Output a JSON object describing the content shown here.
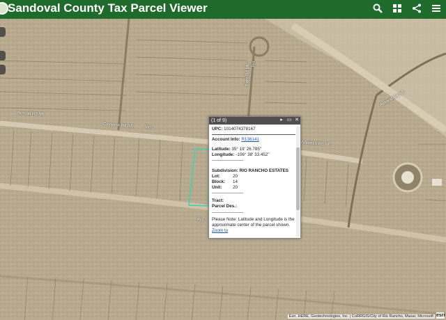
{
  "app": {
    "title": "Sandoval County Tax Parcel Viewer"
  },
  "toolbar": {
    "icons": [
      "search-icon",
      "apps-grid-icon",
      "share-icon",
      "menu-icon"
    ]
  },
  "map": {
    "streets": [
      {
        "label": "Cayenne Rd NE"
      },
      {
        "label": "Vinc"
      },
      {
        "label": "Allineum Rd NE"
      },
      {
        "label": "Tigre Rd NE"
      },
      {
        "label": "Almond Rd NE"
      },
      {
        "label": "Nomad Rd NE"
      },
      {
        "label": "Tex"
      },
      {
        "label": "Pro"
      }
    ],
    "attribution": "Esri, HERE, Geotechnologies, Inc. | CoRRGIS/City of Rio Rancho, Maxar, Microsoft",
    "esri_badge": "esri"
  },
  "popup": {
    "counter": "(1 of 9)",
    "upc_label": "UPC:",
    "upc_value": "1014074378167",
    "account_label": "Account Info:",
    "account_value": "R136141",
    "lat_label": "Latitude:",
    "lat_value": "35° 19' 26.785\"",
    "lon_label": "Longitude:",
    "lon_value": "-106° 38' 33.452\"",
    "divider_text": "------------------------------",
    "subdivision_label": "Subdivision:",
    "subdivision_value": "RIO RANCHO ESTATES",
    "lot_label": "Lot:",
    "lot_value": "20",
    "block_label": "Block:",
    "block_value": "14",
    "unit_label": "Unit:",
    "unit_value": "20",
    "tract_label": "Tract:",
    "parcel_label": "Parcel Des.:",
    "note": "Please Note: Latitude and Longitude is the approximate center of the parcel shown.",
    "zoom_label": "Zoom to"
  }
}
